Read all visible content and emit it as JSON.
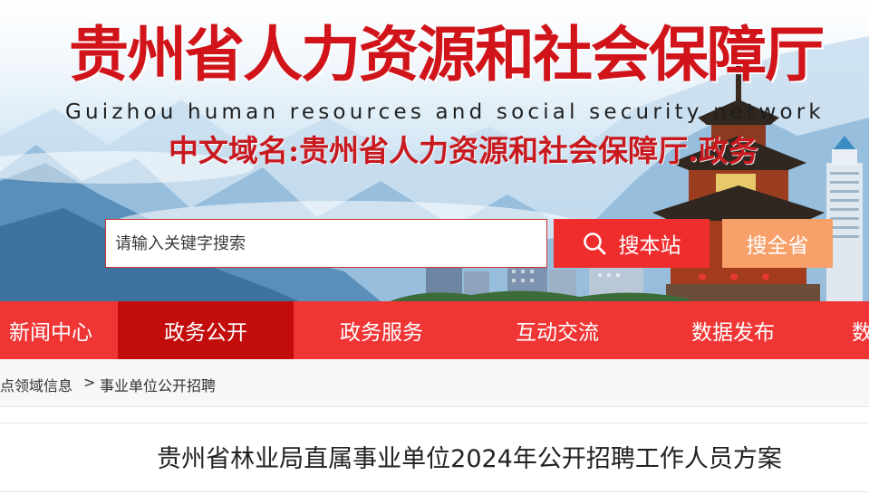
{
  "header": {
    "title_cn": "贵州省人力资源和社会保障厅",
    "title_en": "Guizhou human resources and social security network",
    "domain_text": "中文域名:贵州省人力资源和社会保障厅.政务",
    "gate_plaque": "甲秀楼"
  },
  "search": {
    "placeholder": "请输入关键字搜索",
    "search_site_label": "搜本站",
    "search_province_label": "搜全省"
  },
  "nav": {
    "items": [
      {
        "label": "新闻中心",
        "active": false
      },
      {
        "label": "政务公开",
        "active": true
      },
      {
        "label": "政务服务",
        "active": false
      },
      {
        "label": "互动交流",
        "active": false
      },
      {
        "label": "数据发布",
        "active": false
      },
      {
        "label": "数",
        "active": false
      }
    ]
  },
  "breadcrumb": {
    "items": [
      "点领域信息",
      "事业单位公开招聘"
    ],
    "separator": ">"
  },
  "article": {
    "title": "贵州省林业局直属事业单位2024年公开招聘工作人员方案"
  },
  "colors": {
    "nav_bg": "#f03535",
    "nav_active": "#c30d0d",
    "search_site_bg": "#ef2d2d",
    "search_province_bg": "#f7a06a",
    "title_red": "#d0141a"
  }
}
